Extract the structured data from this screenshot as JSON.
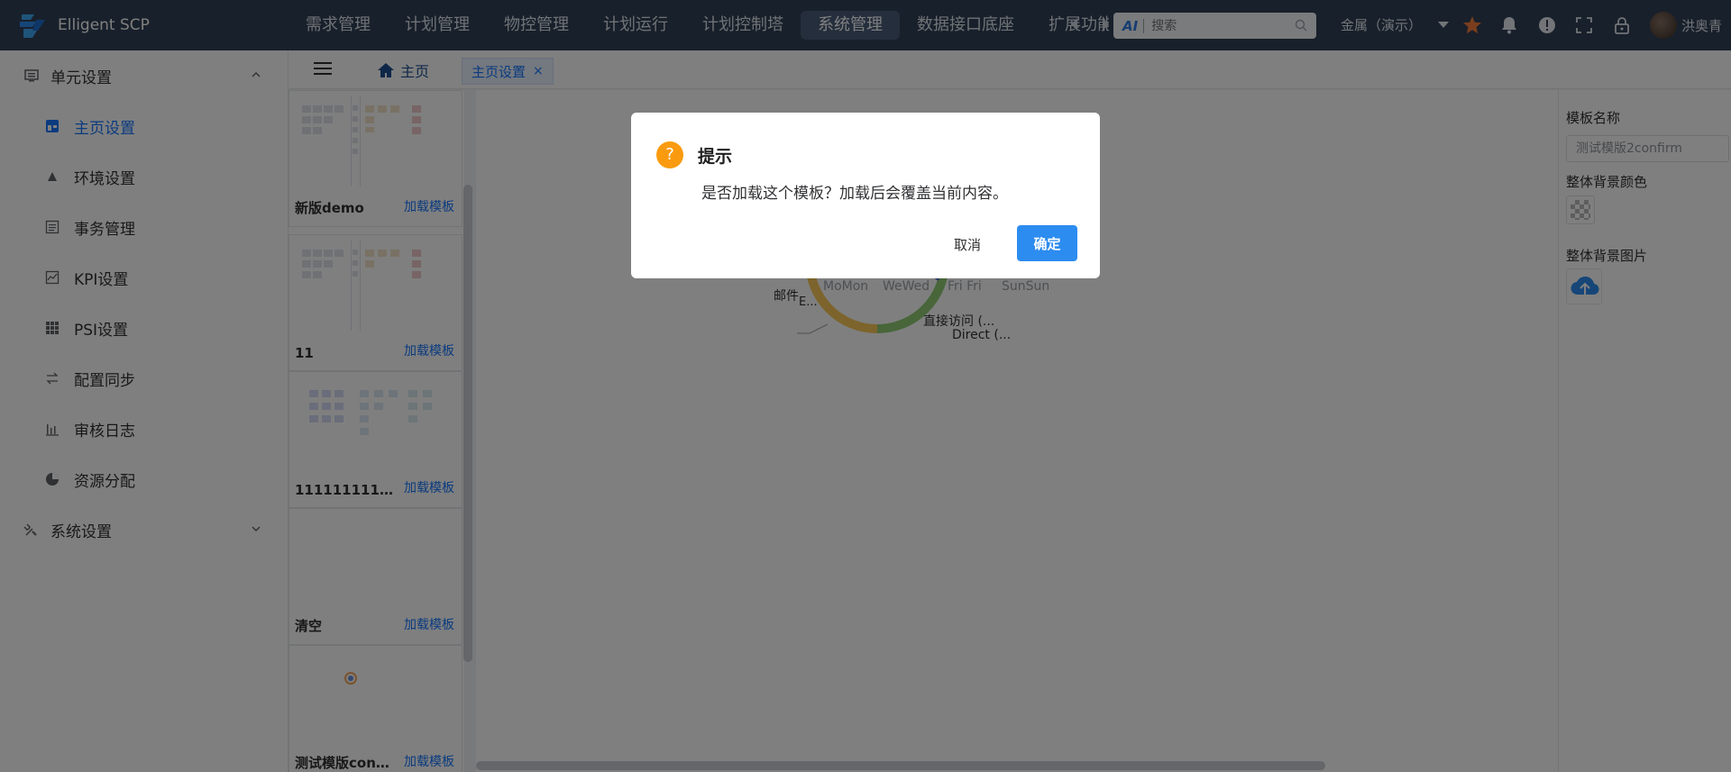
{
  "app": {
    "title": "Elligent SCP"
  },
  "nav": {
    "items": [
      "需求管理",
      "计划管理",
      "物控管理",
      "计划运行",
      "计划控制塔",
      "系统管理",
      "数据接口底座",
      "扩展功能"
    ],
    "active": "系统管理"
  },
  "search": {
    "ai_label": "AI",
    "placeholder": "搜索"
  },
  "tenant": {
    "label": "金属（演示）"
  },
  "user": {
    "name": "洪奥青"
  },
  "sidebar": {
    "group1": "单元设置",
    "items": [
      {
        "label": "主页设置",
        "icon": "dashboard-icon"
      },
      {
        "label": "环境设置",
        "icon": "environment-icon"
      },
      {
        "label": "事务管理",
        "icon": "list-icon"
      },
      {
        "label": "KPI设置",
        "icon": "chart-line-icon"
      },
      {
        "label": "PSI设置",
        "icon": "grid-icon"
      },
      {
        "label": "配置同步",
        "icon": "sync-icon"
      },
      {
        "label": "审核日志",
        "icon": "bar-chart-icon"
      },
      {
        "label": "资源分配",
        "icon": "pie-icon"
      }
    ],
    "group2": "系统设置"
  },
  "tabs": {
    "home": "主页",
    "active": "主页设置",
    "close": "×"
  },
  "templates": [
    {
      "name": "新版demo",
      "action": "加载模板"
    },
    {
      "name": "11",
      "action": "加载模板"
    },
    {
      "name": "11111111111…",
      "action": "加载模板"
    },
    {
      "name": "清空",
      "action": "加载模板"
    },
    {
      "name": "测试模版con…",
      "action": "加载模板"
    }
  ],
  "canvas": {
    "labels": [
      "邮件",
      "E...",
      "MoMon",
      "WeWed",
      "Fri Fri",
      "SunSun",
      "直接访问 (...",
      "Direct (..."
    ]
  },
  "right_panel": {
    "template_name_label": "模板名称",
    "template_name_value": "测试模版2confirm",
    "bg_color_label": "整体背景颜色",
    "bg_image_label": "整体背景图片"
  },
  "dialog": {
    "title": "提示",
    "icon": "?",
    "message": "是否加载这个模板？加载后会覆盖当前内容。",
    "cancel": "取消",
    "ok": "确定"
  },
  "colors": {
    "topbar": "#304156",
    "accent": "#1677ff",
    "primary_button": "#2d8cf0",
    "warning": "#fa9b0f"
  }
}
